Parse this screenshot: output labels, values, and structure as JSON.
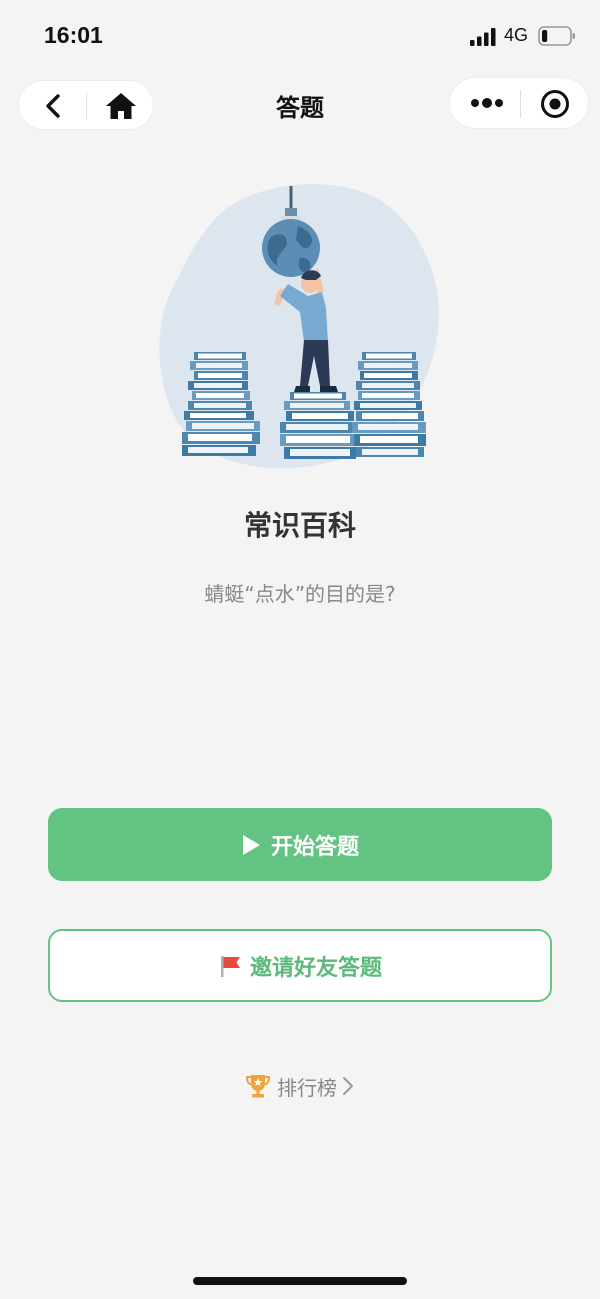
{
  "status_bar": {
    "time": "16:01",
    "network": "4G",
    "battery_level": 0.2,
    "icons": [
      "signal-icon",
      "battery-icon"
    ]
  },
  "nav": {
    "title": "答题",
    "icons": [
      "back-icon",
      "home-icon",
      "more-icon",
      "target-icon"
    ]
  },
  "quiz": {
    "category": "常识百科",
    "question": "蜻蜓“点水”的目的是?"
  },
  "actions": {
    "start_label": "开始答题",
    "start_icon": "play-icon",
    "invite_label": "邀请好友答题",
    "invite_icon": "flag-icon",
    "ranking_label": "排行榜",
    "ranking_icon": "trophy-icon"
  },
  "colors": {
    "primary_green": "#62c383",
    "background": "#f4f4f4",
    "trophy_orange": "#f0a23b",
    "flag_red": "#e64b3c"
  }
}
